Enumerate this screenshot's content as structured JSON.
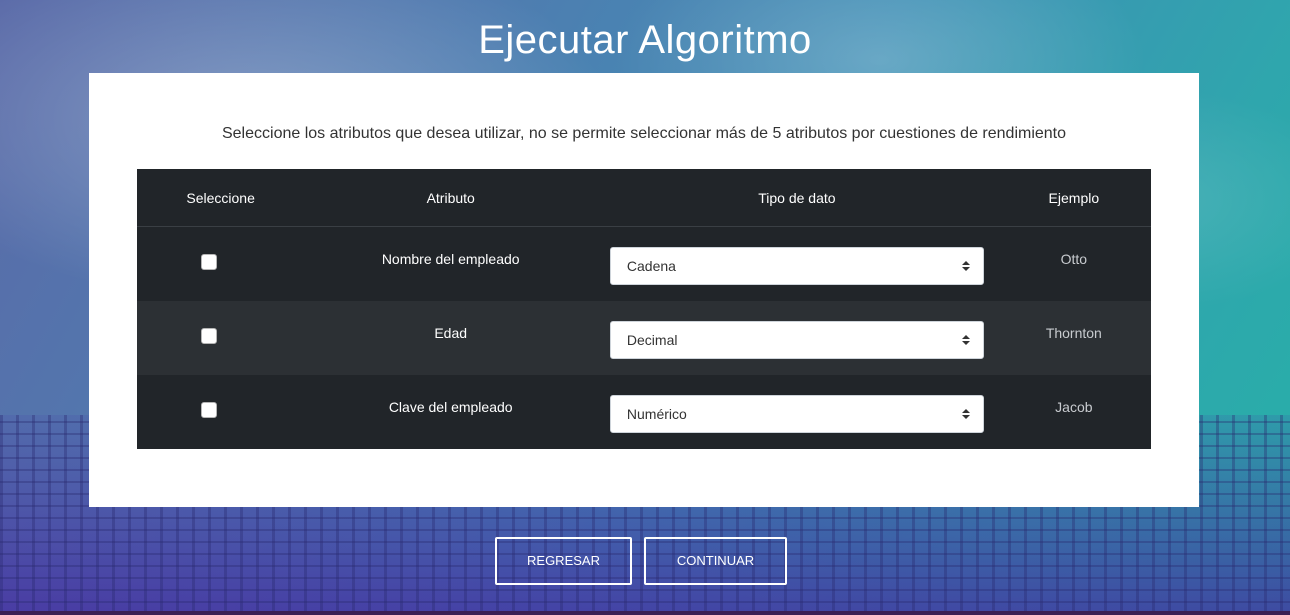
{
  "page": {
    "title": "Ejecutar Algoritmo"
  },
  "card": {
    "instructions": "Seleccione los atributos que desea utilizar, no se permite seleccionar más de 5 atributos por cuestiones de rendimiento"
  },
  "table": {
    "headers": {
      "select": "Seleccione",
      "attribute": "Atributo",
      "type": "Tipo de dato",
      "example": "Ejemplo"
    },
    "rows": [
      {
        "checked": false,
        "attribute": "Nombre del empleado",
        "type": "Cadena",
        "example": "Otto"
      },
      {
        "checked": false,
        "attribute": "Edad",
        "type": "Decimal",
        "example": "Thornton"
      },
      {
        "checked": false,
        "attribute": "Clave del empleado",
        "type": "Numérico",
        "example": "Jacob"
      }
    ]
  },
  "actions": {
    "back_label": "Regresar",
    "continue_label": "Continuar"
  },
  "colors": {
    "table_dark": "#212529",
    "table_stripe": "#2c3034",
    "card_background": "#ffffff"
  }
}
